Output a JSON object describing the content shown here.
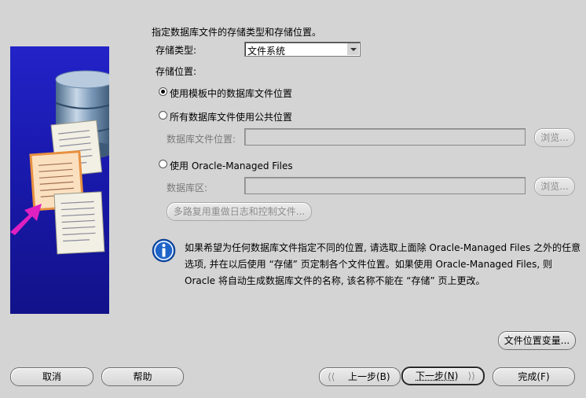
{
  "header": {
    "instruction": "指定数据库文件的存储类型和存储位置。"
  },
  "storage_type": {
    "label": "存储类型:",
    "value": "文件系统"
  },
  "storage_location": {
    "label": "存储位置:",
    "options": [
      {
        "label": "使用模板中的数据库文件位置",
        "selected": true
      },
      {
        "label": "所有数据库文件使用公共位置",
        "selected": false
      },
      {
        "label": "使用 Oracle-Managed Files",
        "selected": false
      }
    ],
    "db_file_location_label": "数据库文件位置:",
    "db_area_label": "数据库区:",
    "browse_label": "浏览...",
    "multiplex_button": "多路复用重做日志和控制文件..."
  },
  "info": {
    "lines": [
      "如果希望为任何数据库文件指定不同的位置, 请选取上面除 Oracle-Managed Files 之外的任意",
      "选项, 并在以后使用 “存储” 页定制各个文件位置。如果使用 Oracle-Managed Files, 则",
      "Oracle 将自动生成数据库文件的名称, 该名称不能在 “存储” 页上更改。"
    ]
  },
  "file_location_variables_button": "文件位置变量...",
  "footer": {
    "cancel": "取消",
    "help": "帮助",
    "back": "上一步(B)",
    "next": "下一步(N)",
    "finish": "完成(F)"
  },
  "colors": {
    "illustration_bg": "#1a1ab0",
    "accent_arrow": "#e020c0",
    "info_icon": "#1e64c8"
  }
}
